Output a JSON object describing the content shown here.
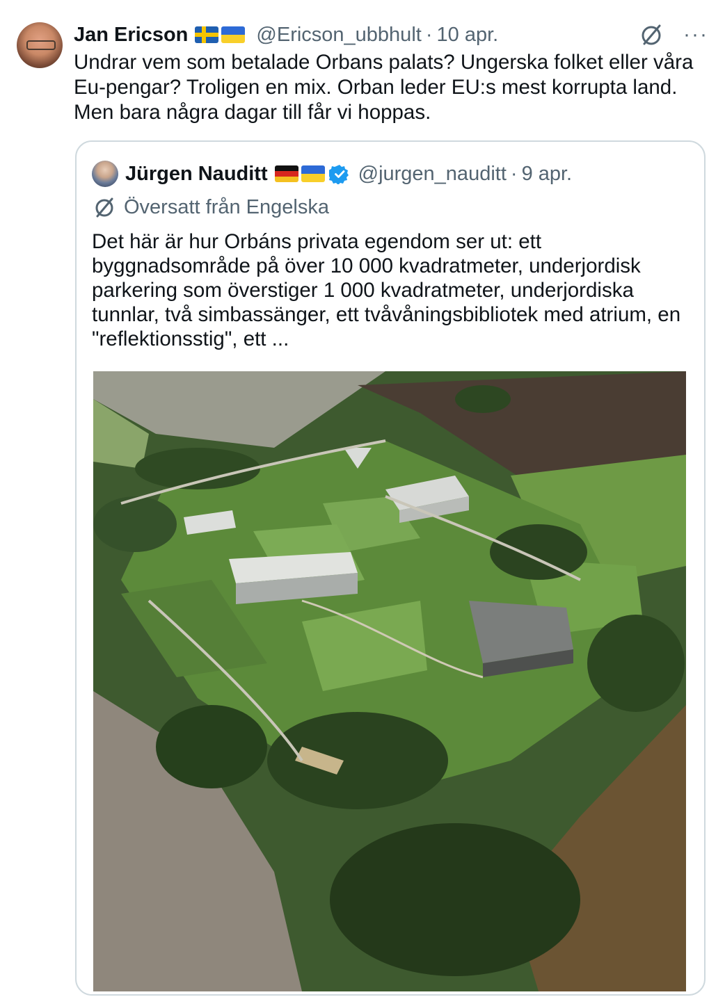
{
  "tweet": {
    "author_name": "Jan Ericson",
    "handle": "@Ericson_ubbhult",
    "separator": "·",
    "date": "10 apr.",
    "text": "Undrar vem som betalade Orbans palats? Ungerska folket eller våra Eu-pengar? Troligen en mix. Orban leder EU:s mest korrupta land. Men bara några dagar till får vi hoppas.",
    "more_label": "···",
    "flags": [
      "swedish-flag",
      "ukrainian-flag"
    ]
  },
  "quoted": {
    "author_name": "Jürgen Nauditt",
    "handle": "@jurgen_nauditt",
    "separator": "·",
    "date": "9 apr.",
    "translated_label": "Översatt från Engelska",
    "text": "Det här är hur Orbáns privata egendom ser ut: ett byggnadsområde på över 10 000 kvadratmeter, underjordisk parkering som överstiger 1 000 kvadratmeter, underjordiska tunnlar, två simbassänger, ett tvåvåningsbibliotek med atrium, en \"reflektionsstig\", ett ...",
    "flags": [
      "german-flag",
      "ukrainian-flag"
    ],
    "verified_color": "#1d9bf0"
  },
  "colors": {
    "text": "#0f1419",
    "secondary": "#536471",
    "border": "#cfd9de"
  }
}
